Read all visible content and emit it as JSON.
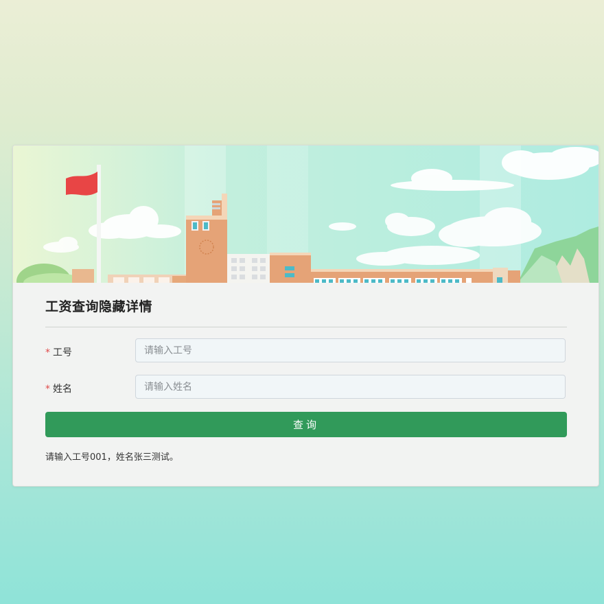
{
  "page": {
    "title": "工资查询隐藏详情"
  },
  "form": {
    "required_mark": "*",
    "employee_id": {
      "label": "工号",
      "placeholder": "请输入工号",
      "value": ""
    },
    "name": {
      "label": "姓名",
      "placeholder": "请输入姓名",
      "value": ""
    },
    "submit_label": "查询"
  },
  "hint": "请输入工号001，姓名张三测试。",
  "colors": {
    "primary_button": "#319a5a",
    "required_mark": "#e04b4b",
    "flag": "#e84545"
  },
  "banner": {
    "scene": "school-campus-illustration"
  }
}
